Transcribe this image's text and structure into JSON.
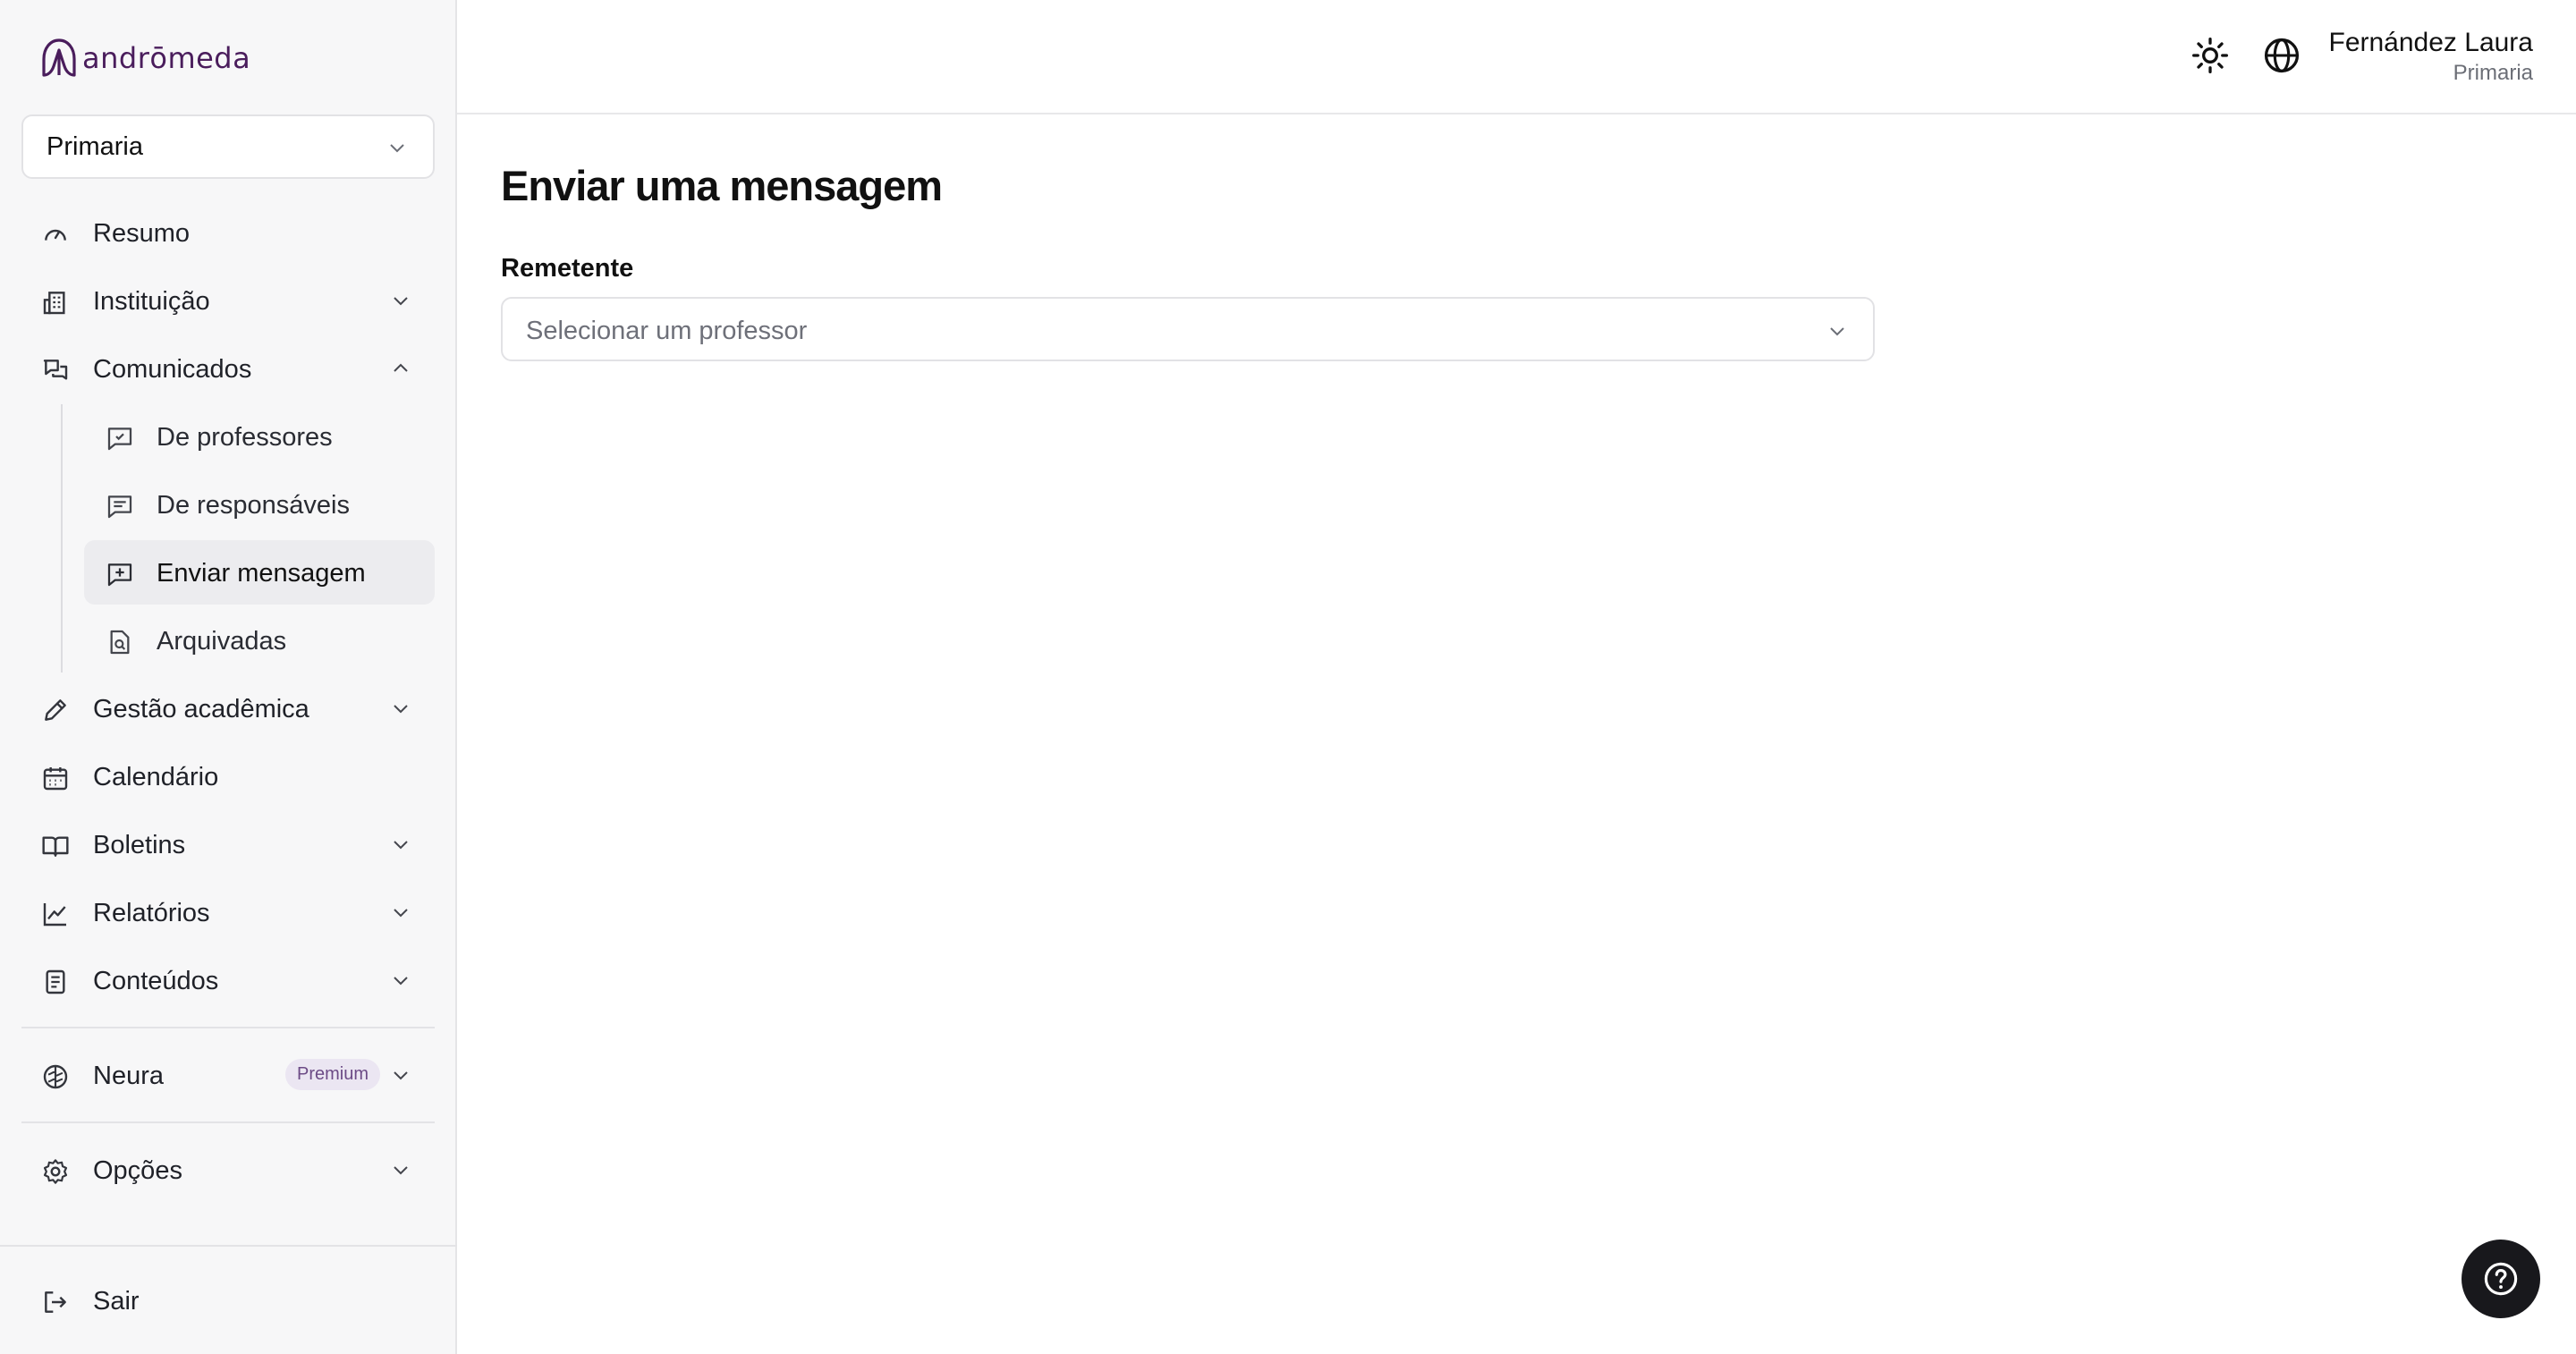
{
  "app": {
    "logo_text": "andrōmeda"
  },
  "sidebar": {
    "selector_value": "Primaria",
    "items": [
      {
        "label": "Resumo"
      },
      {
        "label": "Instituição"
      },
      {
        "label": "Comunicados"
      },
      {
        "label": "Gestão acadêmica"
      },
      {
        "label": "Calendário"
      },
      {
        "label": "Boletins"
      },
      {
        "label": "Relatórios"
      },
      {
        "label": "Conteúdos"
      },
      {
        "label": "Neura",
        "badge": "Premium"
      },
      {
        "label": "Opções"
      },
      {
        "label": "Sair"
      }
    ],
    "subitems": [
      {
        "label": "De professores"
      },
      {
        "label": "De responsáveis"
      },
      {
        "label": "Enviar mensagem",
        "active": true
      },
      {
        "label": "Arquivadas"
      }
    ]
  },
  "header": {
    "user_name": "Fernández Laura",
    "user_role": "Primaria",
    "icons": [
      "sun-icon",
      "globe-icon"
    ]
  },
  "main": {
    "title": "Enviar uma mensagem",
    "field_label": "Remetente",
    "field_placeholder": "Selecionar um professor"
  },
  "colors": {
    "brand": "#4a1d5c",
    "sidebar_bg": "#f7f7f8",
    "active_bg": "#ececef",
    "badge_bg": "#ebe6f2",
    "help_button_bg": "#18181c"
  }
}
